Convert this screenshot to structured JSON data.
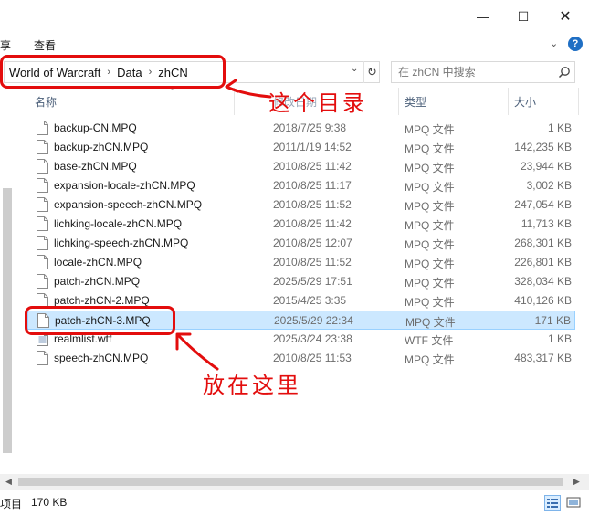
{
  "window": {
    "min_glyph": "—",
    "max_glyph": "☐",
    "close_glyph": "✕"
  },
  "ribbon": {
    "tabs": [
      "享",
      "查看"
    ],
    "expand_glyph": "⌄",
    "help_glyph": "?"
  },
  "address": {
    "crumbs": [
      "World of Warcraft",
      "Data",
      "zhCN"
    ],
    "separator": "›",
    "dropdown_glyph": "⌄",
    "refresh_glyph": "↻"
  },
  "search": {
    "placeholder": "在 zhCN 中搜索"
  },
  "columns": {
    "name": "名称",
    "date": "修改日期",
    "type": "类型",
    "size": "大小"
  },
  "files": [
    {
      "name": "backup-CN.MPQ",
      "date": "2018/7/25 9:38",
      "type": "MPQ 文件",
      "size": "1 KB",
      "selected": false
    },
    {
      "name": "backup-zhCN.MPQ",
      "date": "2011/1/19 14:52",
      "type": "MPQ 文件",
      "size": "142,235 KB",
      "selected": false
    },
    {
      "name": "base-zhCN.MPQ",
      "date": "2010/8/25 11:42",
      "type": "MPQ 文件",
      "size": "23,944 KB",
      "selected": false
    },
    {
      "name": "expansion-locale-zhCN.MPQ",
      "date": "2010/8/25 11:17",
      "type": "MPQ 文件",
      "size": "3,002 KB",
      "selected": false
    },
    {
      "name": "expansion-speech-zhCN.MPQ",
      "date": "2010/8/25 11:52",
      "type": "MPQ 文件",
      "size": "247,054 KB",
      "selected": false
    },
    {
      "name": "lichking-locale-zhCN.MPQ",
      "date": "2010/8/25 11:42",
      "type": "MPQ 文件",
      "size": "11,713 KB",
      "selected": false
    },
    {
      "name": "lichking-speech-zhCN.MPQ",
      "date": "2010/8/25 12:07",
      "type": "MPQ 文件",
      "size": "268,301 KB",
      "selected": false
    },
    {
      "name": "locale-zhCN.MPQ",
      "date": "2010/8/25 11:52",
      "type": "MPQ 文件",
      "size": "226,801 KB",
      "selected": false
    },
    {
      "name": "patch-zhCN.MPQ",
      "date": "2025/5/29 17:51",
      "type": "MPQ 文件",
      "size": "328,034 KB",
      "selected": false
    },
    {
      "name": "patch-zhCN-2.MPQ",
      "date": "2015/4/25 3:35",
      "type": "MPQ 文件",
      "size": "410,126 KB",
      "selected": false
    },
    {
      "name": "patch-zhCN-3.MPQ",
      "date": "2025/5/29 22:34",
      "type": "MPQ 文件",
      "size": "171 KB",
      "selected": true
    },
    {
      "name": "realmlist.wtf",
      "date": "2025/3/24 23:38",
      "type": "WTF 文件",
      "size": "1 KB",
      "selected": false
    },
    {
      "name": "speech-zhCN.MPQ",
      "date": "2010/8/25 11:53",
      "type": "MPQ 文件",
      "size": "483,317 KB",
      "selected": false
    }
  ],
  "status": {
    "items_label": "项目",
    "selected_size": "170 KB"
  },
  "annotations": {
    "path_note": "这个目录",
    "file_note": "放在这里",
    "color": "#e30d0d"
  }
}
